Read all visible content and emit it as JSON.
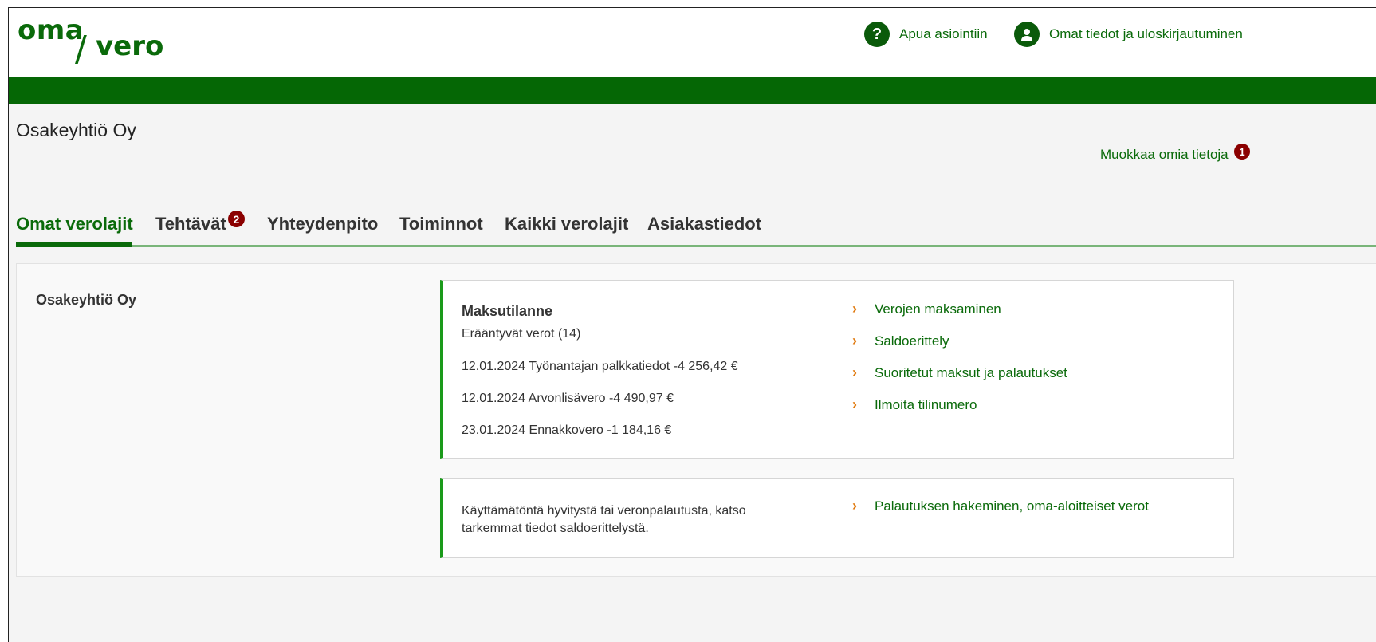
{
  "header": {
    "logo": {
      "oma": "oma",
      "slash": "/",
      "vero": "vero"
    },
    "help_label": "Apua asiointiin",
    "help_icon": "question-circle-icon",
    "profile_label": "Omat tiedot ja uloskirjautuminen",
    "profile_icon": "user-circle-icon"
  },
  "company": {
    "name": "Osakeyhtiö Oy",
    "edit_label": "Muokkaa omia tietoja",
    "edit_badge": "1"
  },
  "tabs": [
    {
      "label": "Omat verolajit",
      "active": true
    },
    {
      "label": "Tehtävät",
      "badge": "2"
    },
    {
      "label": "Yhteydenpito"
    },
    {
      "label": "Toiminnot"
    },
    {
      "label": "Kaikki verolajit"
    },
    {
      "label": "Asiakastiedot"
    }
  ],
  "panel": {
    "title": "Osakeyhtiö Oy",
    "payment_card": {
      "heading": "Maksutilanne",
      "subheading": "Erääntyvät verot (14)",
      "items": [
        "12.01.2024 Työnantajan palkkatiedot -4 256,42 €",
        "12.01.2024 Arvonlisävero -4 490,97 €",
        "23.01.2024 Ennakkovero -1 184,16 €"
      ],
      "links": [
        "Verojen maksaminen",
        "Saldoerittely",
        "Suoritetut maksut ja palautukset",
        "Ilmoita tilinumero"
      ]
    },
    "refund_card": {
      "text": "Käyttämätöntä hyvitystä tai veronpalautusta, katso tarkemmat tiedot saldoerittelystä.",
      "link": "Palautuksen hakeminen, oma-aloitteiset verot"
    }
  },
  "colors": {
    "brand_green": "#056705",
    "link_green": "#0a6a0a",
    "badge_red": "#8b0000",
    "chevron_orange": "#e07a10"
  }
}
